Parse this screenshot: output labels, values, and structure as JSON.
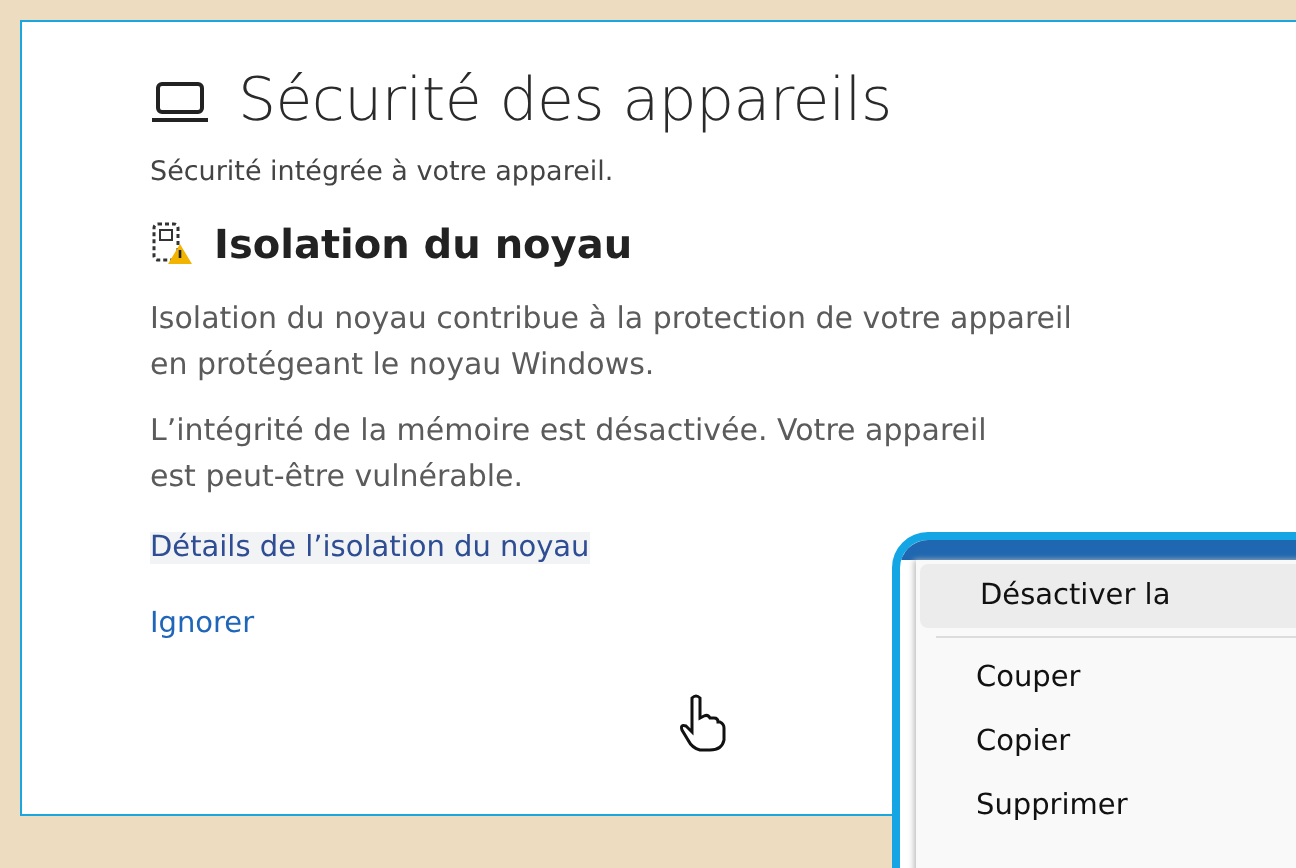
{
  "page": {
    "title": "Sécurité des appareils",
    "subtitle": "Sécurité intégrée à votre appareil."
  },
  "section": {
    "heading": "Isolation du noyau",
    "description": "Isolation du noyau contribue à la protection de votre appareil en protégeant le noyau Windows.",
    "status": "L’intégrité de la mémoire est désactivée. Votre appareil est peut-être vulnérable.",
    "links": [
      {
        "label": "Détails de l’isolation du noyau",
        "hovered": true
      },
      {
        "label": "Ignorer",
        "hovered": false
      }
    ]
  },
  "context_menu": {
    "items": [
      {
        "kind": "item",
        "label": "Désactiver la",
        "selected": true
      },
      {
        "kind": "separator"
      },
      {
        "kind": "item",
        "label": "Couper",
        "selected": false
      },
      {
        "kind": "item",
        "label": "Copier",
        "selected": false
      },
      {
        "kind": "item",
        "label": "Supprimer",
        "selected": false
      }
    ]
  }
}
